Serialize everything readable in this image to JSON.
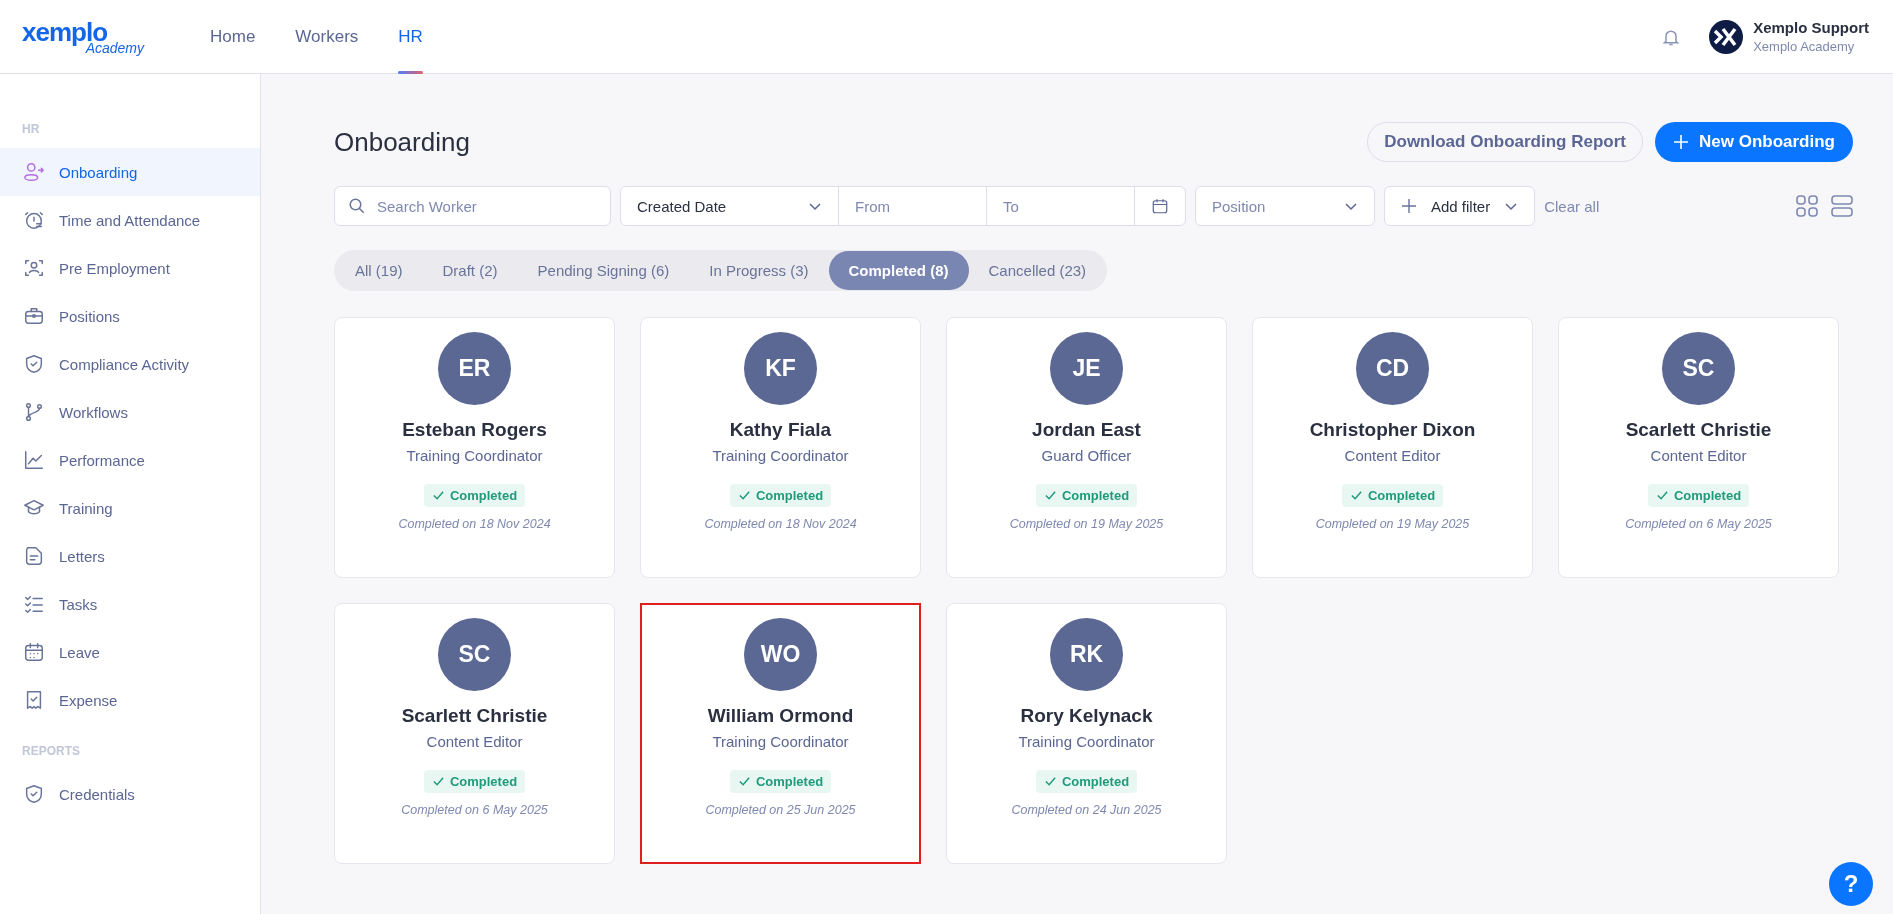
{
  "header": {
    "logo": {
      "wordmark": "xemplo",
      "tagline": "Academy"
    },
    "nav": [
      {
        "label": "Home",
        "selected": false
      },
      {
        "label": "Workers",
        "selected": false
      },
      {
        "label": "HR",
        "selected": true
      }
    ],
    "user": {
      "name": "Xemplo Support",
      "org": "Xemplo Academy"
    }
  },
  "sidebar": {
    "sections": [
      {
        "heading": "HR",
        "items": [
          {
            "label": "Onboarding",
            "selected": true
          },
          {
            "label": "Time and Attendance",
            "selected": false
          },
          {
            "label": "Pre Employment",
            "selected": false
          },
          {
            "label": "Positions",
            "selected": false
          },
          {
            "label": "Compliance Activity",
            "selected": false
          },
          {
            "label": "Workflows",
            "selected": false
          },
          {
            "label": "Performance",
            "selected": false
          },
          {
            "label": "Training",
            "selected": false
          },
          {
            "label": "Letters",
            "selected": false
          },
          {
            "label": "Tasks",
            "selected": false
          },
          {
            "label": "Leave",
            "selected": false
          },
          {
            "label": "Expense",
            "selected": false
          }
        ]
      },
      {
        "heading": "REPORTS",
        "items": [
          {
            "label": "Credentials",
            "selected": false
          }
        ]
      }
    ]
  },
  "page": {
    "title": "Onboarding",
    "download_button": "Download Onboarding Report",
    "new_button": "New Onboarding",
    "filters": {
      "search_placeholder": "Search Worker",
      "date_type": "Created Date",
      "from_placeholder": "From",
      "to_placeholder": "To",
      "position_placeholder": "Position",
      "add_filter": "Add filter",
      "clear_all": "Clear all"
    },
    "status_tabs": [
      {
        "label": "All (19)",
        "selected": false
      },
      {
        "label": "Draft (2)",
        "selected": false
      },
      {
        "label": "Pending Signing (6)",
        "selected": false
      },
      {
        "label": "In Progress (3)",
        "selected": false
      },
      {
        "label": "Completed (8)",
        "selected": true
      },
      {
        "label": "Cancelled (23)",
        "selected": false
      }
    ],
    "cards": [
      {
        "initials": "ER",
        "name": "Esteban Rogers",
        "position": "Training Coordinator",
        "status": "Completed",
        "date": "Completed on 18 Nov 2024",
        "highlighted": false
      },
      {
        "initials": "KF",
        "name": "Kathy Fiala",
        "position": "Training Coordinator",
        "status": "Completed",
        "date": "Completed on 18 Nov 2024",
        "highlighted": false
      },
      {
        "initials": "JE",
        "name": "Jordan East",
        "position": "Guard Officer",
        "status": "Completed",
        "date": "Completed on 19 May 2025",
        "highlighted": false
      },
      {
        "initials": "CD",
        "name": "Christopher Dixon",
        "position": "Content Editor",
        "status": "Completed",
        "date": "Completed on 19 May 2025",
        "highlighted": false
      },
      {
        "initials": "SC",
        "name": "Scarlett Christie",
        "position": "Content Editor",
        "status": "Completed",
        "date": "Completed on 6 May 2025",
        "highlighted": false
      },
      {
        "initials": "SC",
        "name": "Scarlett Christie",
        "position": "Content Editor",
        "status": "Completed",
        "date": "Completed on 6 May 2025",
        "highlighted": false
      },
      {
        "initials": "WO",
        "name": "William Ormond",
        "position": "Training Coordinator",
        "status": "Completed",
        "date": "Completed on 25 Jun 2025",
        "highlighted": true
      },
      {
        "initials": "RK",
        "name": "Rory Kelynack",
        "position": "Training Coordinator",
        "status": "Completed",
        "date": "Completed on 24 Jun 2025",
        "highlighted": false
      }
    ]
  },
  "help_button": "?"
}
